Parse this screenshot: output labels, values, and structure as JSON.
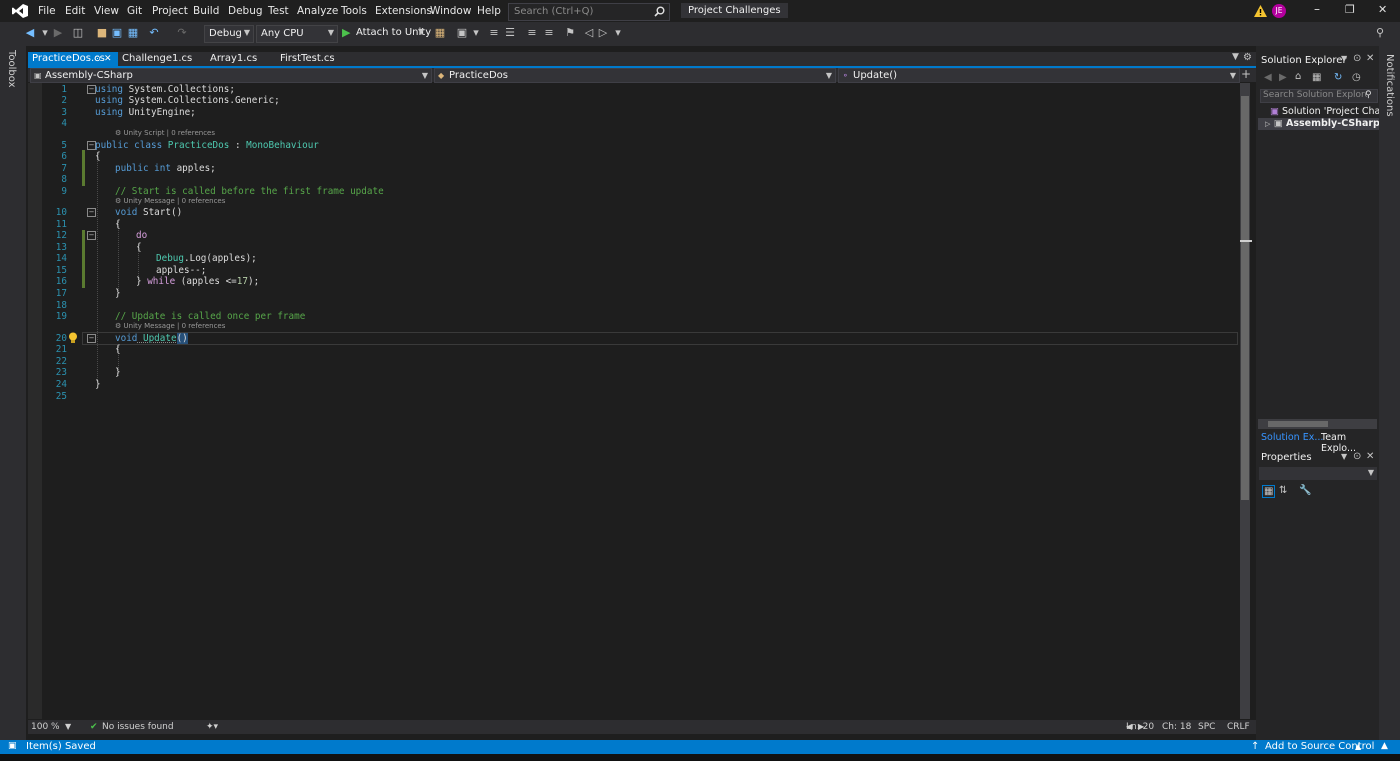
{
  "colors": {
    "accent": "#007acc",
    "keyword": "#569cd6",
    "type": "#4ec9b0",
    "comment": "#57a64a",
    "control": "#d8a0df",
    "number": "#b5cea8",
    "line_number": "#2b91af",
    "profile_badge": "#b4009e",
    "warning": "#f4c430"
  },
  "menu": {
    "items": [
      "File",
      "Edit",
      "View",
      "Git",
      "Project",
      "Build",
      "Debug",
      "Test",
      "Analyze",
      "Tools",
      "Extensions",
      "Window",
      "Help"
    ],
    "search_placeholder": "Search (Ctrl+Q)",
    "project_name": "Project Challenges",
    "profile_initials": "JE"
  },
  "toolbar": {
    "configuration": "Debug",
    "platform": "Any CPU",
    "attach_label": "Attach to Unity"
  },
  "toolbox": {
    "label": "Toolbox"
  },
  "tabs": [
    {
      "label": "PracticeDos.cs"
    },
    {
      "label": "Challenge1.cs"
    },
    {
      "label": "Array1.cs"
    },
    {
      "label": "FirstTest.cs"
    }
  ],
  "nav": {
    "project": "Assembly-CSharp",
    "type": "PracticeDos",
    "member": "Update()"
  },
  "editor": {
    "line_numbers": [
      "1",
      "2",
      "3",
      "4",
      "5",
      "6",
      "7",
      "8",
      "9",
      "10",
      "11",
      "12",
      "13",
      "14",
      "15",
      "16",
      "17",
      "18",
      "19",
      "20",
      "21",
      "22",
      "23",
      "24",
      "25"
    ],
    "lines": {
      "l1_kw": "using",
      "l1_rest": " System.Collections;",
      "l2_kw": "using",
      "l2_rest": " System.Collections.Generic;",
      "l3_kw": "using",
      "l3_rest": " UnityEngine;",
      "l5_kw": "public class",
      "l5_name": " PracticeDos",
      "l5_sep": " : ",
      "l5_base": "MonoBehaviour",
      "l6": "{",
      "l7_kw": "public int",
      "l7_rest": " apples;",
      "l9": "// Start is called before the first frame update",
      "l10_kw": "void",
      "l10_rest": " Start()",
      "l11": "{",
      "l12": "do",
      "l13": "{",
      "l14_cls": "Debug",
      "l14_rest": ".Log(apples);",
      "l15": "apples--;",
      "l16_a": "} ",
      "l16_kw": "while",
      "l16_b": " (apples <=",
      "l16_num": "17",
      "l16_c": ");",
      "l17": "}",
      "l19": "// Update is called once per frame",
      "l20_kw": "void",
      "l20_name": " Update",
      "l20_parens": "()",
      "l21": "{",
      "l23": "}",
      "l24": "}"
    },
    "codelens": {
      "class": "Unity Script | 0 references",
      "start": "Unity Message | 0 references",
      "update": "Unity Message | 0 references"
    }
  },
  "editor_status": {
    "zoom": "100 %",
    "issues": "No issues found",
    "line": "Ln: 20",
    "col": "Ch: 18",
    "whitespace": "SPC",
    "line_ending": "CRLF"
  },
  "solution_explorer": {
    "title": "Solution Explorer",
    "search_placeholder": "Search Solution Explore",
    "solution_item": "Solution 'Project Challer",
    "project_item": "Assembly-CSharp",
    "tab_solution": "Solution Ex...",
    "tab_team": "Team Explo..."
  },
  "properties": {
    "title": "Properties"
  },
  "notifications": {
    "label": "Notifications"
  },
  "statusbar": {
    "message": "Item(s) Saved",
    "source_control": "Add to Source Control"
  }
}
